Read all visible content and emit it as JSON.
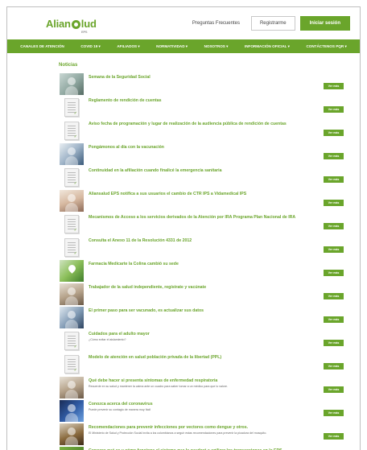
{
  "header": {
    "logo_main": "Alian",
    "logo_end": "lud",
    "logo_sub": "EPS",
    "faq": "Preguntas Frecuentes",
    "register": "Registrarme",
    "login": "Iniciar sesión"
  },
  "nav": [
    "CANALES DE ATENCIÓN",
    "COVID 19 ▾",
    "AFILIADOS ▾",
    "NORMATIVIDAD ▾",
    "NOSOTROS ▾",
    "INFORMACIÓN OFICIAL ▾",
    "CONTÁCTENOS PQR ▾"
  ],
  "section_title": "Noticias",
  "button_label": "Ver más",
  "news": [
    {
      "title": "Semana de la Seguridad Social",
      "sub": "",
      "thumb": "photo-a"
    },
    {
      "title": "Reglamento de rendición de cuentas",
      "sub": "",
      "thumb": "doc"
    },
    {
      "title": "Aviso fecha de programación y lugar de realización de la audiencia pública de rendición de cuentas",
      "sub": "",
      "thumb": "doc"
    },
    {
      "title": "Pongámonos al día con la vacunación",
      "sub": "",
      "thumb": "photo-c"
    },
    {
      "title": "Continuidad en la afiliación cuando finalicé la emergencia sanitaria",
      "sub": "",
      "thumb": "doc"
    },
    {
      "title": "Aliansalud EPS notifica a sus usuarios el cambio de CTR IPS a Vidamedical IPS",
      "sub": "",
      "thumb": "photo-b"
    },
    {
      "title": "Mecanismos de Acceso a los servicios derivados de la Atención por IRA Programa Plan Nacional de IRA",
      "sub": "",
      "thumb": "doc"
    },
    {
      "title": "Consulta el Anexo 11 de la Resolución 4331 de 2012",
      "sub": "",
      "thumb": "doc"
    },
    {
      "title": "Farmacia Medicarte la Colina cambió su sede",
      "sub": "",
      "thumb": "photo-d"
    },
    {
      "title": "Trabajador de la salud independiente, regístrate y vacúnate",
      "sub": "",
      "thumb": "photo-e"
    },
    {
      "title": "El primer paso para ser vacunado, es actualizar sus datos",
      "sub": "",
      "thumb": "photo-f"
    },
    {
      "title": "Cuidados para el adulto mayor",
      "sub": "¿Cómo evitar el aislamiento?",
      "thumb": "doc"
    },
    {
      "title": "Modelo de atención en salud población privada de la libertad (PPL)",
      "sub": "",
      "thumb": "doc"
    },
    {
      "title": "Qué debe hacer si presenta síntomas de enfermedad respiratoria",
      "sub": "Recuerde en su salud y mantener la calma ante un cuadro para saber tomar a un médico para que lo valore.",
      "thumb": "photo-e"
    },
    {
      "title": "Conozca acerca del coronavirus",
      "sub": "Puede prevenir su contagio de manera muy fácil",
      "thumb": "photo-g"
    },
    {
      "title": "Recomendaciones para prevenir infecciones por vectores como dengue y otros.",
      "sub": "El Ministerio de Salud y Protección Social invita a los colombianos a seguir estas recomendaciones para prevenir la picadura del mosquito.",
      "thumb": "photo-h"
    },
    {
      "title": "Conozca qué es y cómo funciona el sistema que le ayudará a agilizar los transacciones en la EPS.",
      "sub": "",
      "thumb": "photo-i"
    }
  ]
}
